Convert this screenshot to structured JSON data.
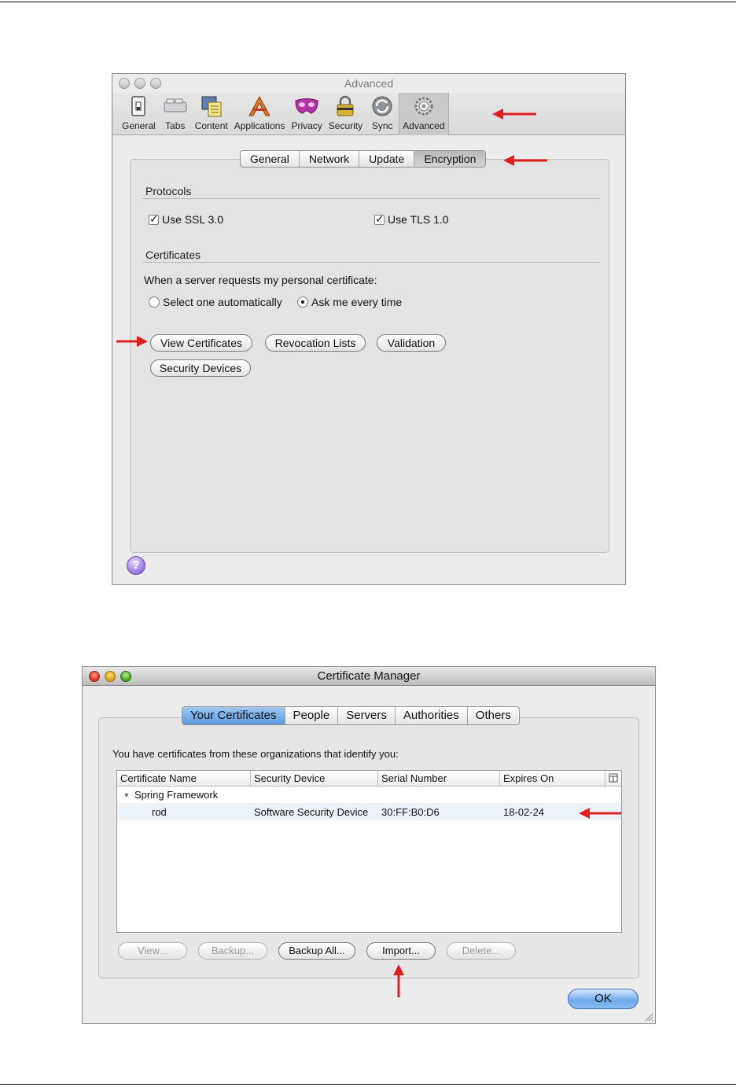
{
  "prefs_window": {
    "title": "Advanced",
    "toolbar": [
      {
        "label": "General",
        "icon": "switch-icon"
      },
      {
        "label": "Tabs",
        "icon": "tabs-icon"
      },
      {
        "label": "Content",
        "icon": "content-icon"
      },
      {
        "label": "Applications",
        "icon": "applications-icon"
      },
      {
        "label": "Privacy",
        "icon": "mask-icon"
      },
      {
        "label": "Security",
        "icon": "lock-icon"
      },
      {
        "label": "Sync",
        "icon": "sync-icon"
      },
      {
        "label": "Advanced",
        "icon": "gear-icon"
      }
    ],
    "active_tool": "Advanced",
    "tabs": [
      "General",
      "Network",
      "Update",
      "Encryption"
    ],
    "active_tab": "Encryption",
    "protocols": {
      "heading": "Protocols",
      "ssl_label": "Use SSL 3.0",
      "tls_label": "Use TLS 1.0"
    },
    "certificates": {
      "heading": "Certificates",
      "prompt": "When a server requests my personal certificate:",
      "radio_auto": "Select one automatically",
      "radio_ask": "Ask me every time",
      "buttons": {
        "view": "View Certificates",
        "revocation": "Revocation Lists",
        "validation": "Validation",
        "devices": "Security Devices"
      }
    },
    "help_label": "?"
  },
  "cert_manager": {
    "title": "Certificate Manager",
    "tabs": [
      "Your Certificates",
      "People",
      "Servers",
      "Authorities",
      "Others"
    ],
    "active_tab": "Your Certificates",
    "description": "You have certificates from these organizations that identify you:",
    "columns": [
      "Certificate Name",
      "Security Device",
      "Serial Number",
      "Expires On"
    ],
    "group": "Spring Framework",
    "row": {
      "name": "rod",
      "device": "Software Security Device",
      "serial": "30:FF:B0:D6",
      "expires": "18-02-24"
    },
    "buttons": {
      "view": "View...",
      "backup": "Backup...",
      "backup_all": "Backup All...",
      "import": "Import...",
      "delete": "Delete..."
    },
    "ok_label": "OK"
  },
  "colors": {
    "annotation_arrow": "#e02020",
    "selected_tab_blue": "#5a9be0"
  }
}
